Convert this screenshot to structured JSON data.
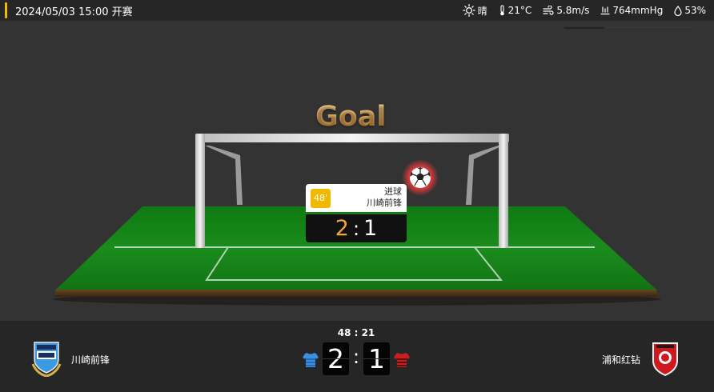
{
  "header": {
    "kickoff": "2024/05/03 15:00 开赛",
    "weather": {
      "condition": "晴",
      "temperature": "21°C",
      "wind": "5.8m/s",
      "pressure": "764mmHg",
      "humidity": "53%"
    }
  },
  "pitch": {
    "title": "Goal",
    "popup": {
      "minute": "48'",
      "event": "进球",
      "team": "川崎前锋",
      "home_score": "2",
      "separator": ":",
      "away_score": "1"
    }
  },
  "scoreboard": {
    "clock": "48 : 21",
    "home": {
      "name": "川崎前锋",
      "score": "2",
      "kit_color": "#3a8fe0"
    },
    "away": {
      "name": "浦和红钻",
      "score": "1",
      "kit_color": "#c81e1e"
    },
    "separator": ":"
  },
  "colors": {
    "accent": "#f0b800",
    "goal_orange": "#f0a63a",
    "pitch_green": "#1f8f1f"
  }
}
